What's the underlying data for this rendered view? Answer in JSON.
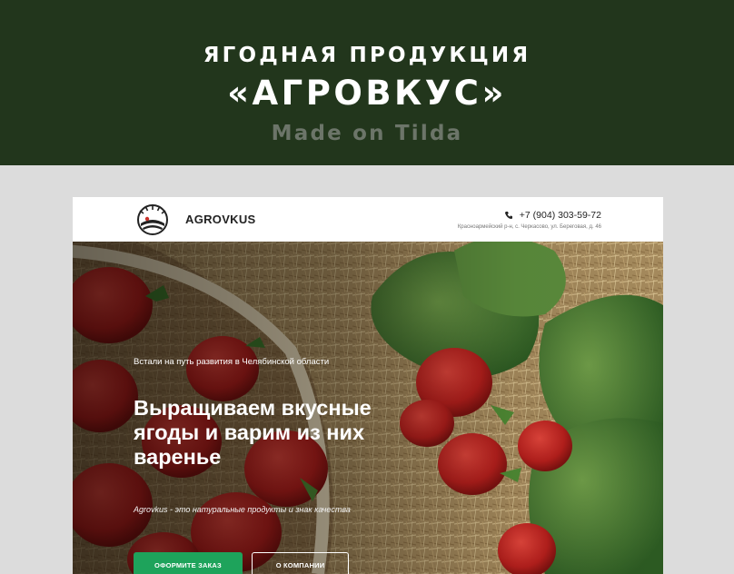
{
  "banner": {
    "line1": "ЯГОДНАЯ ПРОДУКЦИЯ",
    "line2": "«АГРОВКУС»",
    "line3": "Made on Tilda"
  },
  "site": {
    "header": {
      "logo_text": "AGROVKUS",
      "phone": "+7 (904) 303-59-72",
      "address": "Красноармейский р-н, с. Черкасово, ул. Береговая, д. 46"
    },
    "hero": {
      "kicker": "Встали на путь развития в Челябинской области",
      "title_lines": [
        "Выращиваем вкусные",
        "ягоды и варим из них",
        "варенье"
      ],
      "subtitle": "Agrovkus - это натуральные продукты и знак качества",
      "order_button": "ОФОРМИТЕ ЗАКАЗ",
      "about_button": "О КОМПАНИИ"
    }
  },
  "colors": {
    "banner_bg": "#22361c",
    "page_bg": "#dcdcdc",
    "order_button": "#1ea35b"
  },
  "icons": [
    "logo-emblem-icon",
    "phone-icon"
  ]
}
